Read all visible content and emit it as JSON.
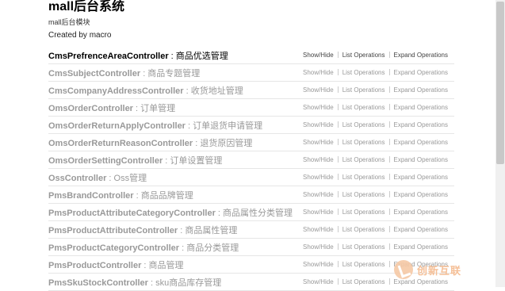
{
  "header": {
    "title": "mall后台系统",
    "subtitle": "mall后台模块",
    "created_by": "Created by macro"
  },
  "operations": [
    {
      "controller": "CmsPrefrenceAreaController",
      "description": " : 商品优选管理"
    },
    {
      "controller": "CmsSubjectController",
      "description": " : 商品专题管理"
    },
    {
      "controller": "CmsCompanyAddressController",
      "description": " : 收货地址管理"
    },
    {
      "controller": "OmsOrderController",
      "description": " : 订单管理"
    },
    {
      "controller": "OmsOrderReturnApplyController",
      "description": " : 订单退货申请管理"
    },
    {
      "controller": "OmsOrderReturnReasonController",
      "description": " : 退货原因管理"
    },
    {
      "controller": "OmsOrderSettingController",
      "description": " : 订单设置管理"
    },
    {
      "controller": "OssController",
      "description": " : Oss管理"
    },
    {
      "controller": "PmsBrandController",
      "description": " : 商品品牌管理"
    },
    {
      "controller": "PmsProductAttributeCategoryController",
      "description": " : 商品属性分类管理"
    },
    {
      "controller": "PmsProductAttributeController",
      "description": " : 商品属性管理"
    },
    {
      "controller": "PmsProductCategoryController",
      "description": " : 商品分类管理"
    },
    {
      "controller": "PmsProductController",
      "description": " : 商品管理"
    },
    {
      "controller": "PmsSkuStockController",
      "description": " : sku商品库存管理"
    }
  ],
  "actions": {
    "show_hide": "Show/Hide",
    "list_operations": "List Operations",
    "expand_operations": "Expand Operations"
  },
  "watermark": {
    "text": "创新互联"
  }
}
